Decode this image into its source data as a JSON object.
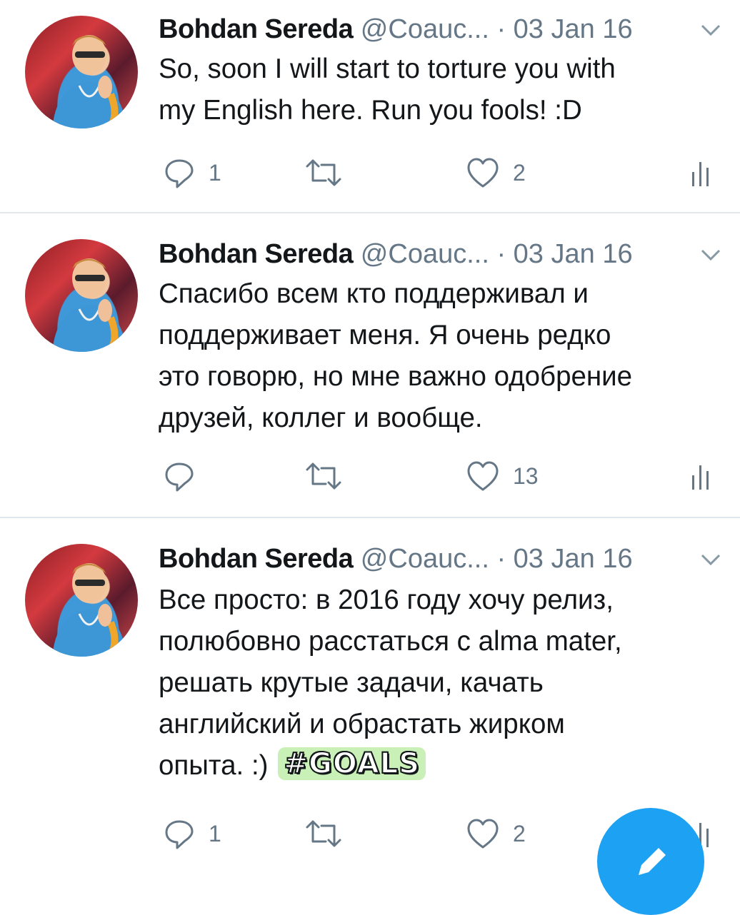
{
  "tweets": [
    {
      "author_name": "Bohdan Sereda",
      "handle": "@Coauc...",
      "separator": "·",
      "date": "03 Jan 16",
      "text_lines": [
        "So, soon I will start to torture you with",
        "my English here. Run you fools! :D"
      ],
      "reply_count": "1",
      "retweet_count": "",
      "like_count": "2"
    },
    {
      "author_name": "Bohdan Sereda",
      "handle": "@Coauc...",
      "separator": "·",
      "date": "03 Jan 16",
      "text_lines": [
        "Спасибо всем кто поддерживал и",
        "поддерживает меня. Я очень редко",
        "это говорю, но мне важно одобрение",
        "друзей, коллег и вообще."
      ],
      "reply_count": "",
      "retweet_count": "",
      "like_count": "13"
    },
    {
      "author_name": "Bohdan Sereda",
      "handle": "@Coauc...",
      "separator": "·",
      "date": "03 Jan 16",
      "text_lines": [
        "Все просто: в 2016 году хочу релиз,",
        "полюбовно расстаться с alma mater,",
        "решать крутые задачи, качать",
        "английский и обрастать жирком",
        "опыта. :)"
      ],
      "sticker": "#GOALS",
      "reply_count": "1",
      "retweet_count": "",
      "like_count": "2"
    }
  ],
  "colors": {
    "accent": "#1da1f2",
    "secondary_text": "#657786",
    "divider": "#e1e8ed"
  },
  "icons": [
    "reply-icon",
    "retweet-icon",
    "like-icon",
    "analytics-icon",
    "chevron-down-icon",
    "compose-icon"
  ]
}
